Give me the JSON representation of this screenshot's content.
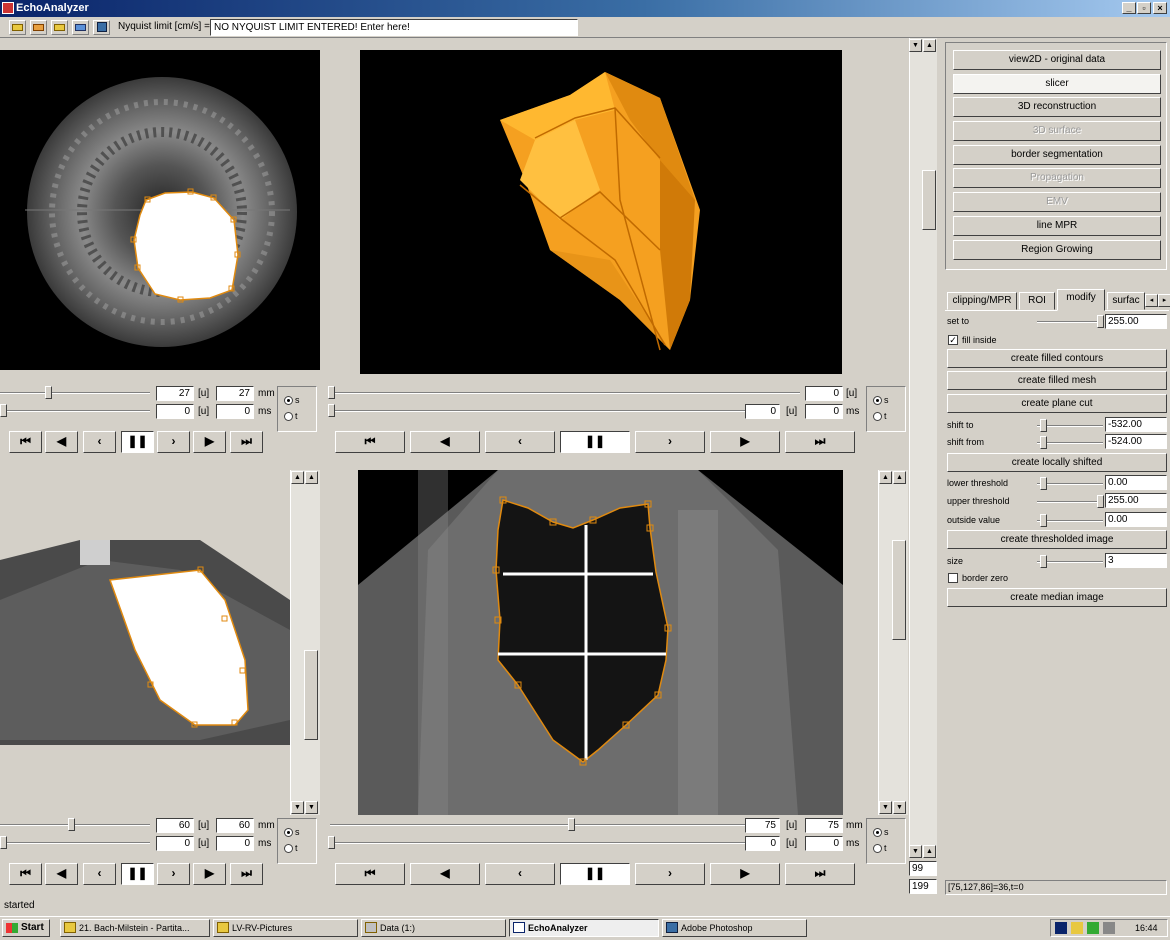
{
  "window": {
    "title": "EchoAnalyzer",
    "controls": {
      "minimize": "_",
      "maximize": "▫",
      "close": "×"
    }
  },
  "toolbar": {
    "icons": [
      "open-folder-icon",
      "open-folder-icon",
      "open-folder-icon",
      "open-folder-icon",
      "save-icon"
    ],
    "nyquist_label": "Nyquist limit [cm/s] =",
    "nyquist_value": "NO NYQUIST LIMIT ENTERED! Enter here!"
  },
  "views": {
    "top_left": {
      "slider1_value": "27",
      "slider1_bracket": "[u]",
      "slider1_value2": "27",
      "slider1_unit": "mm",
      "slider2_value": "0",
      "slider2_bracket": "[u]",
      "slider2_value2": "0",
      "slider2_unit": "ms",
      "radio_s": "s",
      "radio_t": "t"
    },
    "top_right": {
      "slider1_value": "0",
      "slider1_bracket": "[u]",
      "slider2_value": "0",
      "slider2_bracket": "[u]",
      "slider2_value2": "0",
      "slider2_unit": "ms",
      "radio_s": "s",
      "radio_t": "t"
    },
    "bottom_left": {
      "slider1_value": "60",
      "slider1_bracket": "[u]",
      "slider1_value2": "60",
      "slider1_unit": "mm",
      "slider2_value": "0",
      "slider2_bracket": "[u]",
      "slider2_value2": "0",
      "slider2_unit": "ms",
      "radio_s": "s",
      "radio_t": "t"
    },
    "bottom_right": {
      "slider1_value": "75",
      "slider1_bracket": "[u]",
      "slider1_value2": "75",
      "slider1_unit": "mm",
      "slider2_value": "0",
      "slider2_bracket": "[u]",
      "slider2_value2": "0",
      "slider2_unit": "ms",
      "radio_s": "s",
      "radio_t": "t"
    },
    "playback": {
      "first": "⏮",
      "prev": "◀",
      "back": "‹",
      "pause": "❚❚",
      "fwd": "›",
      "next": "▶",
      "last": "⏭"
    }
  },
  "right_panel": {
    "buttons": [
      {
        "label": "view2D - original data",
        "state": "normal"
      },
      {
        "label": "slicer",
        "state": "active"
      },
      {
        "label": "3D reconstruction",
        "state": "normal"
      },
      {
        "label": "3D surface",
        "state": "disabled"
      },
      {
        "label": "border segmentation",
        "state": "normal"
      },
      {
        "label": "Propagation",
        "state": "disabled"
      },
      {
        "label": "EMV",
        "state": "disabled"
      },
      {
        "label": "line MPR",
        "state": "normal"
      },
      {
        "label": "Region Growing",
        "state": "normal"
      }
    ],
    "tabs": [
      "clipping/MPR",
      "ROI",
      "modify",
      "surfac"
    ],
    "selected_tab": "modify",
    "modify": {
      "set_to_label": "set to",
      "set_to_value": "255.00",
      "fill_inside_label": "fill inside",
      "create_filled_contours": "create filled contours",
      "create_filled_mesh": "create filled mesh",
      "create_plane_cut": "create plane cut",
      "shift_to_label": "shift to",
      "shift_to_value": "-532.00",
      "shift_from_label": "shift from",
      "shift_from_value": "-524.00",
      "create_locally_shifted": "create locally shifted",
      "lower_threshold_label": "lower threshold",
      "lower_threshold_value": "0.00",
      "upper_threshold_label": "upper threshold",
      "upper_threshold_value": "255.00",
      "outside_value_label": "outside value",
      "outside_value_value": "0.00",
      "create_thresholded_image": "create thresholded image",
      "size_label": "size",
      "size_value": "3",
      "border_zero_label": "border zero",
      "create_median_image": "create median image"
    },
    "coord_readout": "[75,127,86]=36,t=0"
  },
  "center_scroll": {
    "value1": "99",
    "value2": "199"
  },
  "status": {
    "text": "started"
  },
  "taskbar": {
    "start": "Start",
    "tasks": [
      {
        "label": "21. Bach-Milstein - Partita...",
        "active": false
      },
      {
        "label": "LV-RV-Pictures",
        "active": false
      },
      {
        "label": "Data (1:)",
        "active": false
      },
      {
        "label": "EchoAnalyzer",
        "active": true
      },
      {
        "label": "Adobe Photoshop",
        "active": false
      }
    ],
    "clock": "16:44"
  },
  "colors": {
    "title_start": "#0a246a",
    "title_end": "#a6caf0",
    "face": "#d4d0c8",
    "contour": "#e08a10",
    "mesh": "#f5a020"
  }
}
